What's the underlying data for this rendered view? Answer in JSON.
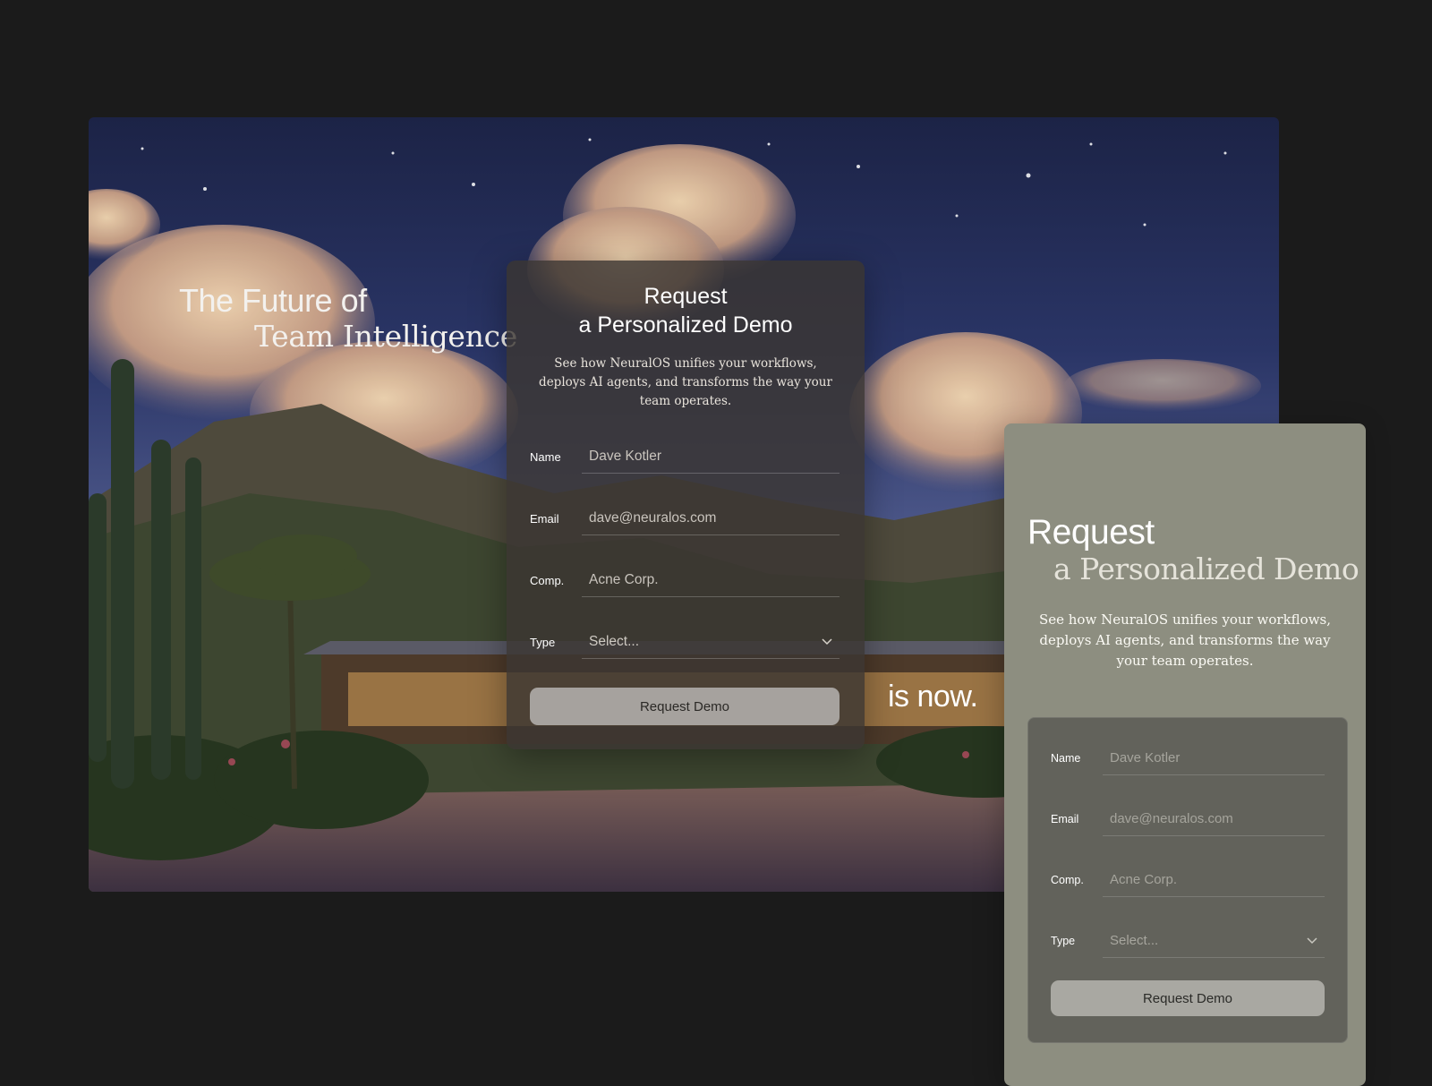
{
  "hero": {
    "headline_line1": "The Future of",
    "headline_line2": "Team Intelligence",
    "tagline": "is now."
  },
  "demo_form": {
    "title_line1": "Request",
    "title_line2": "a Personalized Demo",
    "description": "See how NeuralOS unifies your workflows, deploys AI agents, and transforms the way your team operates.",
    "fields": {
      "name": {
        "label": "Name",
        "placeholder": "Dave Kotler"
      },
      "email": {
        "label": "Email",
        "placeholder": "dave@neuralos.com"
      },
      "company": {
        "label": "Comp.",
        "placeholder": "Acne Corp."
      },
      "type": {
        "label": "Type",
        "selected": "Select..."
      }
    },
    "submit_label": "Request Demo"
  },
  "side_card": {
    "title_line1": "Request",
    "title_line2": "a Personalized Demo",
    "description": "See how NeuralOS unifies your workflows, deploys AI agents, and transforms the way your team operates.",
    "fields": {
      "name": {
        "label": "Name",
        "placeholder": "Dave Kotler"
      },
      "email": {
        "label": "Email",
        "placeholder": "dave@neuralos.com"
      },
      "company": {
        "label": "Comp.",
        "placeholder": "Acne Corp."
      },
      "type": {
        "label": "Type",
        "selected": "Select..."
      }
    },
    "submit_label": "Request Demo"
  },
  "icons": {
    "dropdown": "chevron-down-icon"
  },
  "colors": {
    "page_bg": "#1b1b1b",
    "sage_card": "#8d8e80",
    "glass_panel": "#3a3632",
    "button": "#a6a29e"
  }
}
